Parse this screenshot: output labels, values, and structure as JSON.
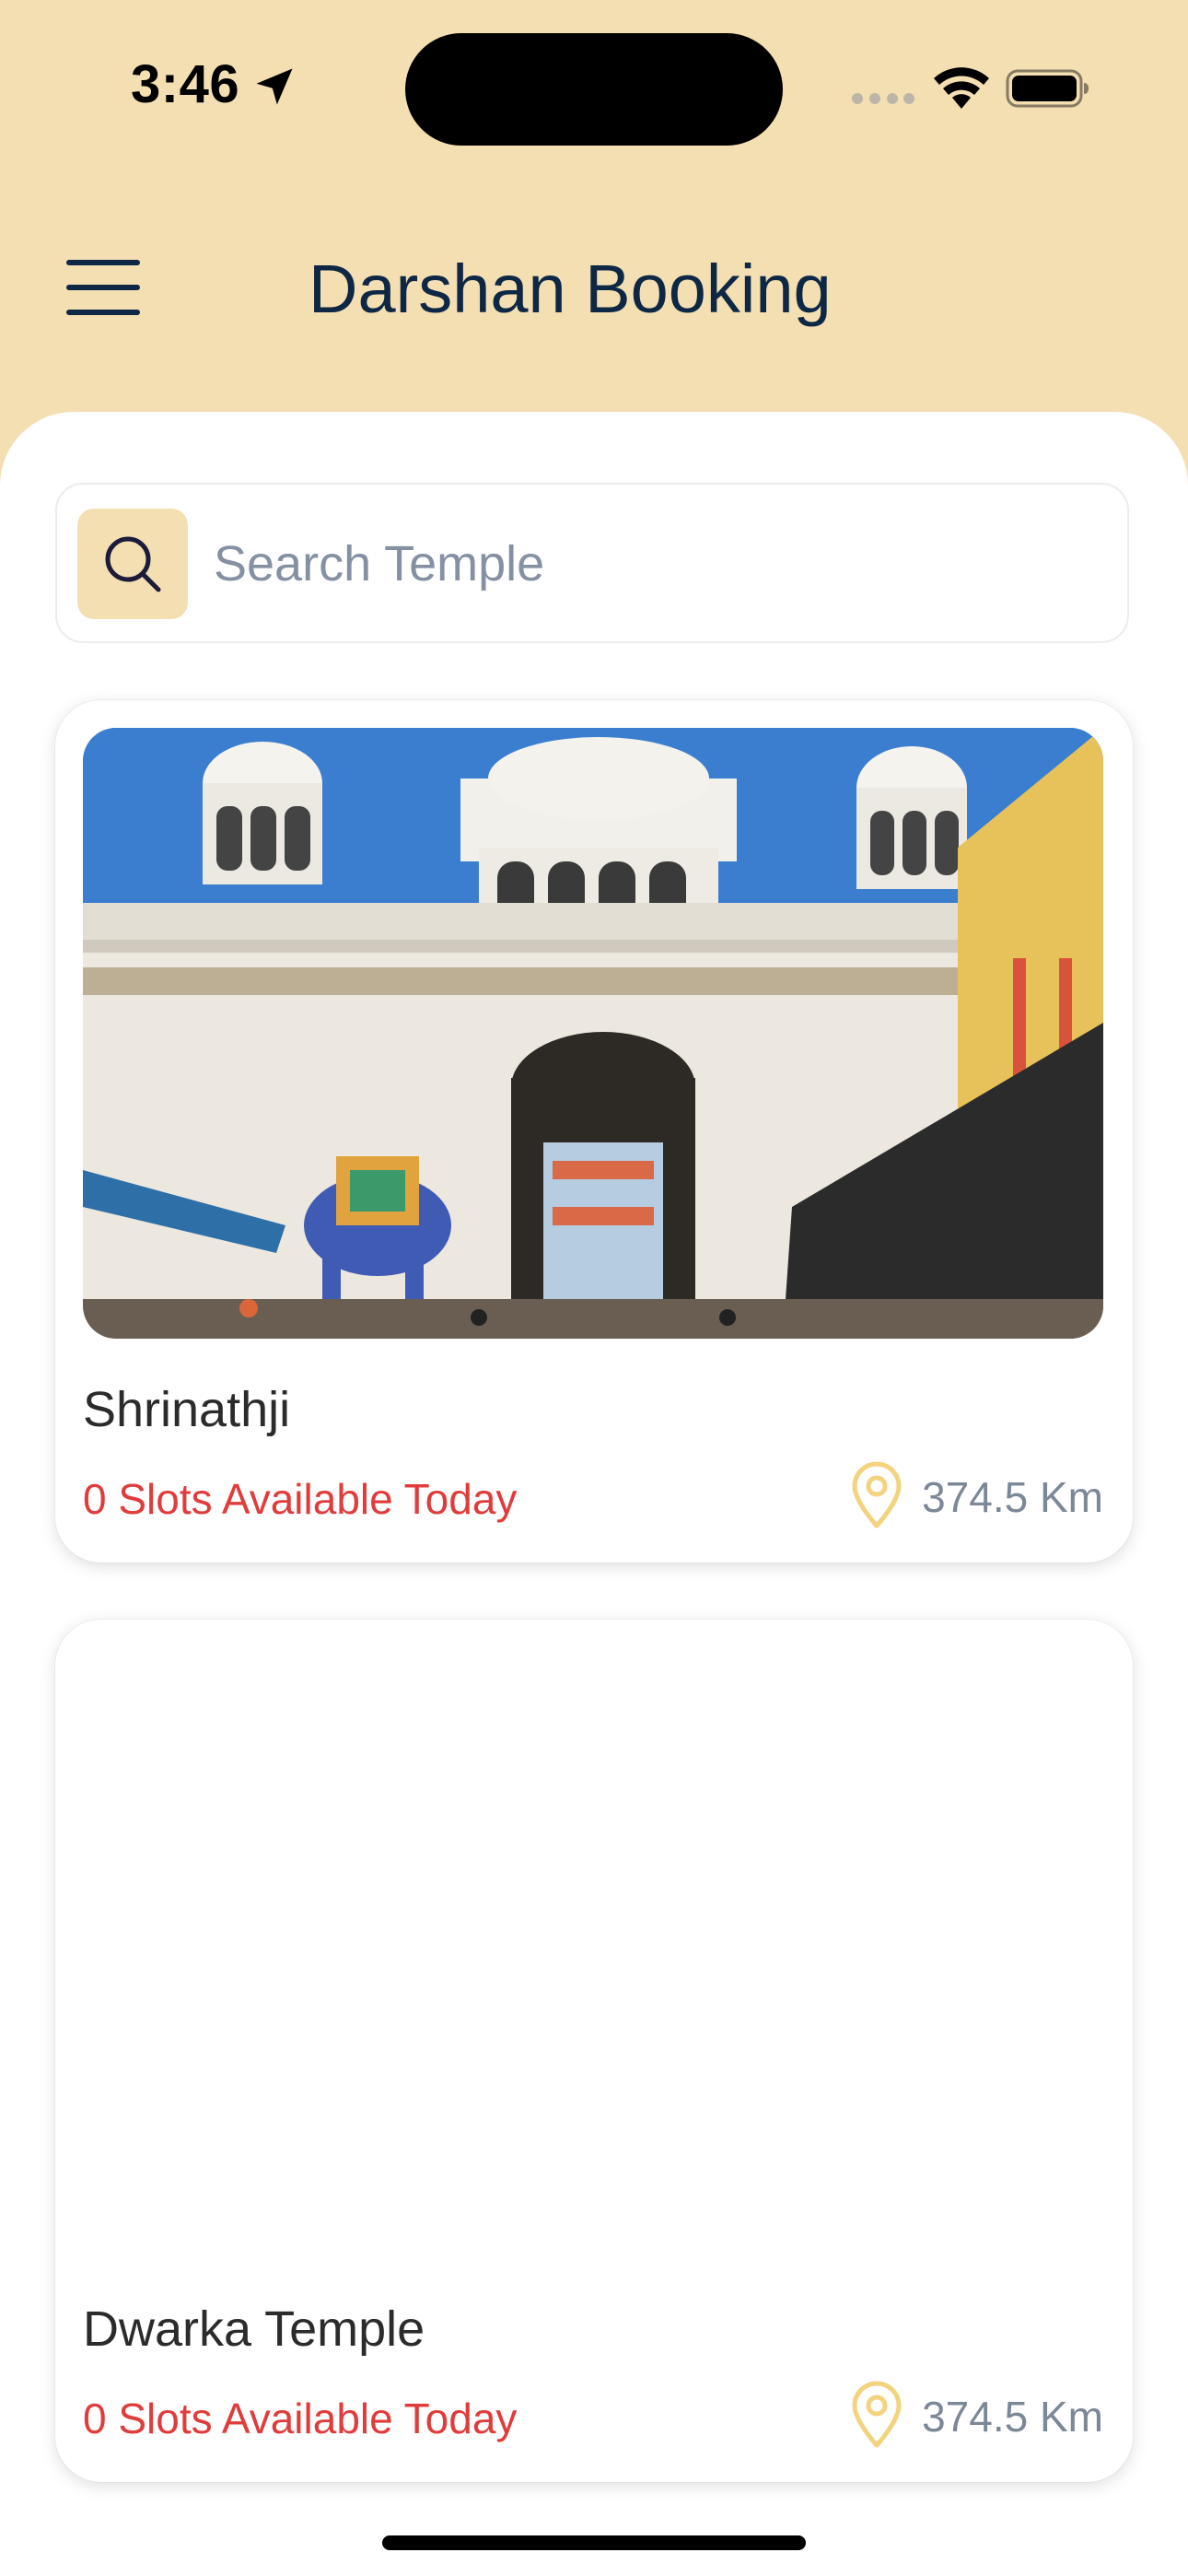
{
  "status_bar": {
    "time": "3:46"
  },
  "header": {
    "title": "Darshan Booking"
  },
  "search": {
    "placeholder": "Search Temple",
    "value": ""
  },
  "temples": [
    {
      "name": "Shrinathji",
      "slots_text": "0 Slots Available Today",
      "distance": "374.5 Km"
    },
    {
      "name": "Dwarka Temple",
      "slots_text": "0 Slots Available Today",
      "distance": "374.5 Km"
    }
  ],
  "colors": {
    "header_bg": "#F4DFB3",
    "title_text": "#0E2744",
    "slots_text": "#E03C3C",
    "distance_text": "#7C8797",
    "pin_icon": "#F4D37E"
  },
  "icons": {
    "menu": "hamburger-menu-icon",
    "search": "search-icon",
    "location": "location-pin-icon"
  }
}
